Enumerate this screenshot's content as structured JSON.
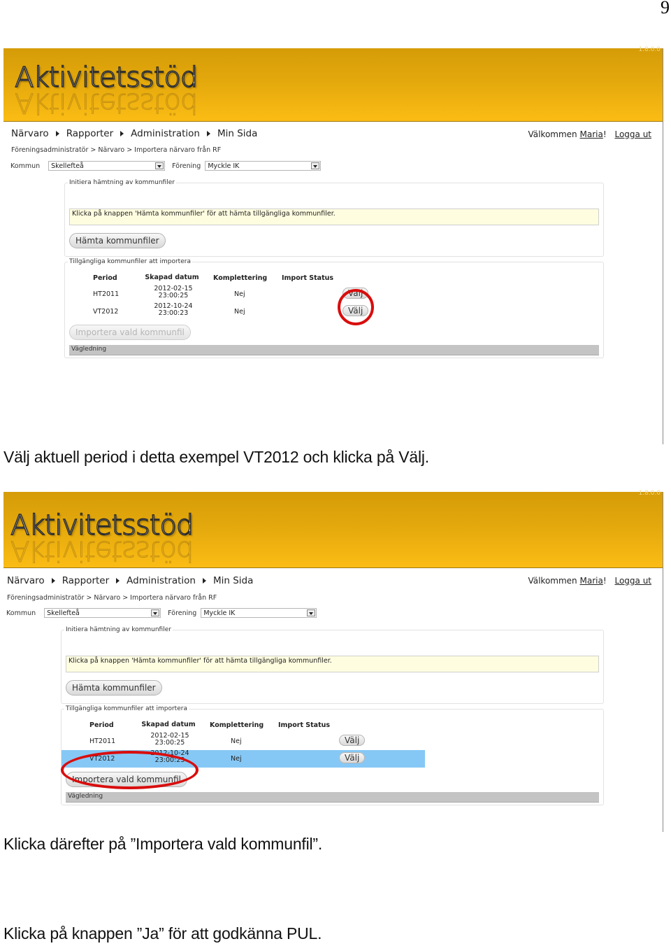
{
  "page_number": "9",
  "app": {
    "title": "Aktivitetsstöd",
    "version": "1.8.0.0",
    "nav": [
      "Närvaro",
      "Rapporter",
      "Administration",
      "Min Sida"
    ],
    "welcome_prefix": "Välkommen",
    "user_name": "Maria",
    "welcome_suffix": "!",
    "logout": "Logga ut",
    "breadcrumb": "Föreningsadministratör > Närvaro > Importera närvaro från RF",
    "filters": {
      "kommun_label": "Kommun",
      "kommun_value": "Skellefteå",
      "forening_label": "Förening",
      "forening_value": "Myckle IK"
    },
    "box1": {
      "legend": "Initiera hämtning av kommunfiler",
      "info": "Klicka på knappen 'Hämta kommunfiler' för att hämta tillgängliga kommunfiler.",
      "button": "Hämta kommunfiler"
    },
    "box2": {
      "legend": "Tillgängliga kommunfiler att importera",
      "columns": [
        "Period",
        "Skapad datum",
        "Komplettering",
        "Import Status"
      ],
      "rows": [
        {
          "period": "HT2011",
          "date": "2012-02-15",
          "time": "23:00:25",
          "komplettering": "Nej",
          "status": "",
          "action": "Välj"
        },
        {
          "period": "VT2012",
          "date": "2012-10-24",
          "time": "23:00:23",
          "komplettering": "Nej",
          "status": "",
          "action": "Välj"
        }
      ],
      "import_button": "Importera vald kommunfil",
      "guide": "Vägledning"
    }
  },
  "screenshots": [
    {
      "selected_row": null,
      "import_enabled": false,
      "highlight": "Välj (VT2012)"
    },
    {
      "selected_row": "VT2012",
      "import_enabled": true,
      "highlight": "Importera vald kommunfil"
    }
  ],
  "captions": [
    "Välj aktuell period i detta exempel VT2012 och klicka på Välj.",
    "Klicka därefter på ”Importera vald kommunfil”.",
    "Klicka på knappen ”Ja” för att godkänna PUL."
  ],
  "colors": {
    "banner_top": "#d69c08",
    "banner_bottom": "#fbbc14",
    "info_bg": "#fffde0",
    "selected_row": "#86c8f5",
    "annotation": "#d90d0d",
    "guide_bar": "#c4c4c4"
  }
}
